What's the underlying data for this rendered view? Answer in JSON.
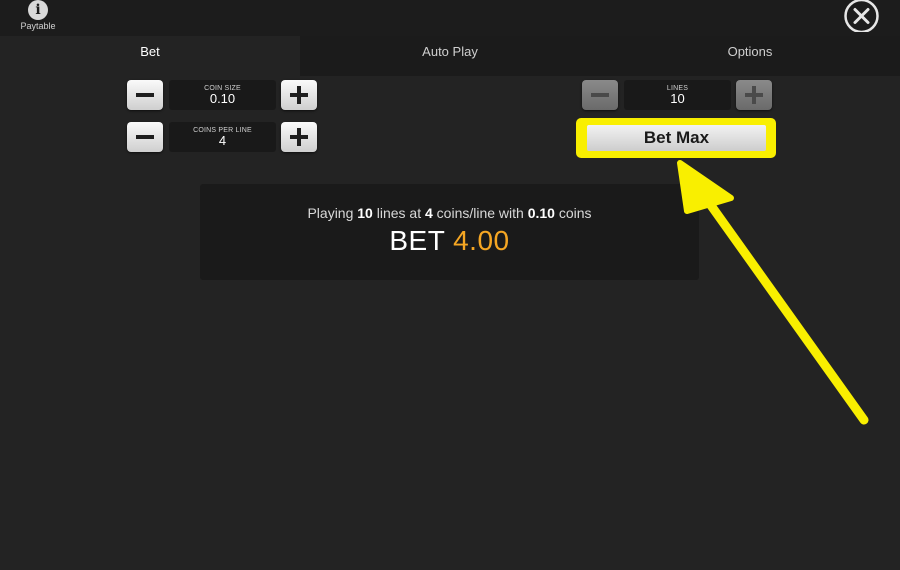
{
  "header": {
    "paytable_icon": "info-icon",
    "paytable_glyph": "i",
    "paytable_label": "Paytable",
    "close_icon": "close-icon"
  },
  "tabs": [
    {
      "label": "Bet",
      "active": true
    },
    {
      "label": "Auto Play",
      "active": false
    },
    {
      "label": "Options",
      "active": false
    }
  ],
  "controls": {
    "coin_size": {
      "label": "COIN SIZE",
      "value": "0.10"
    },
    "coins_per_line": {
      "label": "COINS PER LINE",
      "value": "4"
    },
    "lines": {
      "label": "LINES",
      "value": "10",
      "buttons_disabled": true
    }
  },
  "bet_max": {
    "label": "Bet Max",
    "highlight_color": "#f9ef00"
  },
  "summary": {
    "prefix": "Playing",
    "lines": "10",
    "mid1": "lines at",
    "coins": "4",
    "mid2": "coins/line with",
    "coin_size": "0.10",
    "suffix": "coins",
    "bet_word": "BET",
    "bet_amount": "4.00",
    "bet_amount_color": "#f5a623"
  },
  "annotation": {
    "type": "arrow",
    "color": "#f9ef00"
  }
}
